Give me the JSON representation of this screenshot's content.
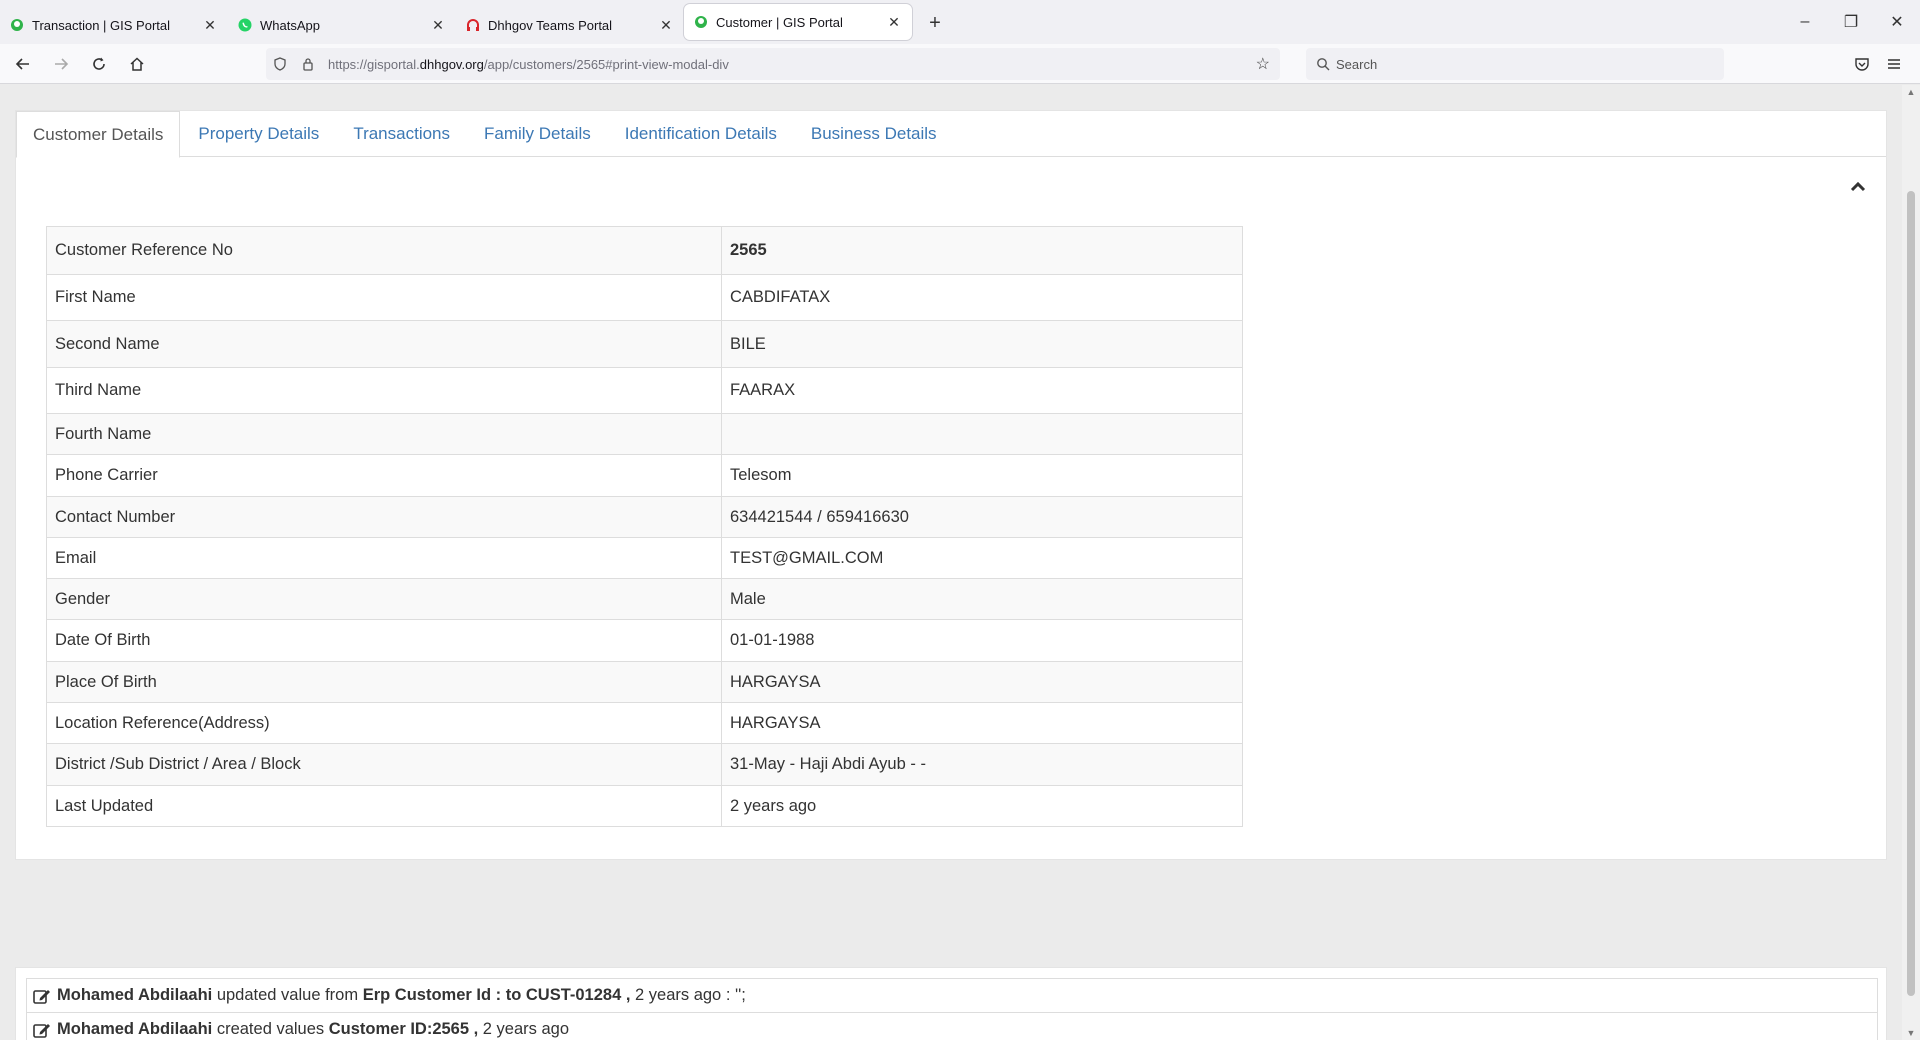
{
  "browser": {
    "tabs": [
      {
        "title": "Transaction | GIS Portal",
        "favicon": "gis-portal-icon",
        "color": "#2fb34a"
      },
      {
        "title": "WhatsApp",
        "favicon": "whatsapp-icon",
        "color": "#25d366"
      },
      {
        "title": "Dhhgov Teams Portal",
        "favicon": "teams-portal-icon",
        "color": "#d9262c"
      },
      {
        "title": "Customer | GIS Portal",
        "favicon": "gis-portal-icon",
        "color": "#2fb34a"
      }
    ],
    "url_prefix": "https://gisportal.",
    "url_domain": "dhhgov.org",
    "url_path": "/app/customers/2565#print-view-modal-div",
    "search_placeholder": "Search"
  },
  "page_tabs": [
    "Customer Details",
    "Property Details",
    "Transactions",
    "Family Details",
    "Identification Details",
    "Business Details"
  ],
  "customer": {
    "rows": [
      {
        "label": "Customer Reference No",
        "value": "2565"
      },
      {
        "label": "First Name",
        "value": "CABDIFATAX"
      },
      {
        "label": "Second Name",
        "value": "BILE"
      },
      {
        "label": "Third Name",
        "value": "FAARAX"
      },
      {
        "label": "Fourth Name",
        "value": ""
      },
      {
        "label": "Phone Carrier",
        "value": "Telesom"
      },
      {
        "label": "Contact Number",
        "value": "634421544 / 659416630"
      },
      {
        "label": "Email",
        "value": "TEST@GMAIL.COM"
      },
      {
        "label": "Gender",
        "value": "Male"
      },
      {
        "label": "Date Of Birth",
        "value": "01-01-1988"
      },
      {
        "label": "Place Of Birth",
        "value": "HARGAYSA"
      },
      {
        "label": "Location Reference(Address)",
        "value": "HARGAYSA"
      },
      {
        "label": "District /Sub District / Area / Block",
        "value": "31-May - Haji Abdi Ayub - -"
      },
      {
        "label": "Last Updated",
        "value": "2 years ago"
      }
    ]
  },
  "activity": [
    {
      "user": "Mohamed Abdilaahi",
      "action": " updated value from ",
      "subject": "Erp Customer Id : to CUST-01284 ,",
      "tail": " 2 years ago : '';"
    },
    {
      "user": "Mohamed Abdilaahi",
      "action": " created values ",
      "subject": "Customer ID:2565 ,",
      "tail": " 2 years ago"
    }
  ]
}
